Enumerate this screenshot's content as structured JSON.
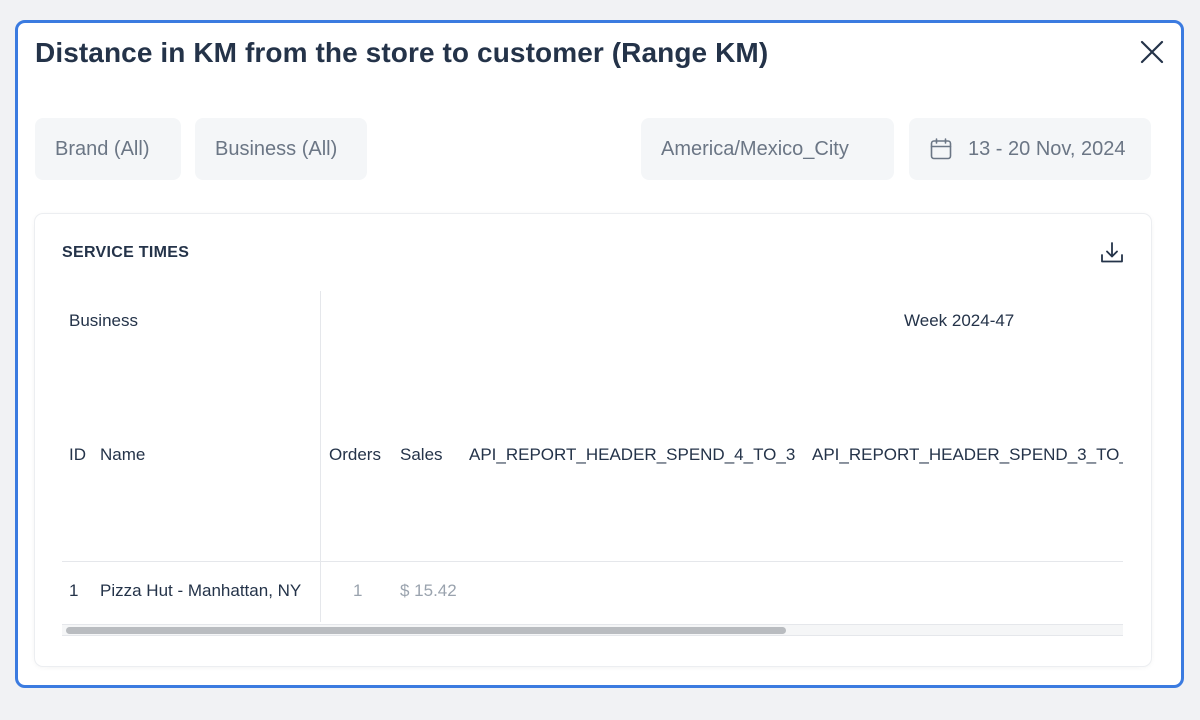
{
  "modal": {
    "title": "Distance in KM from the store to customer (Range KM)"
  },
  "filters": {
    "brand": "Brand (All)",
    "business": "Business (All)",
    "timezone": "America/Mexico_City",
    "date_range": "13 - 20 Nov, 2024"
  },
  "card": {
    "title": "SERVICE TIMES"
  },
  "table": {
    "group_headers": {
      "business": "Business",
      "week": "Week 2024-47"
    },
    "columns": {
      "id": "ID",
      "name": "Name",
      "orders": "Orders",
      "sales": "Sales",
      "spend_4_to_3": "API_REPORT_HEADER_SPEND_4_TO_3",
      "spend_3_to": "API_REPORT_HEADER_SPEND_3_TO_"
    },
    "rows": [
      {
        "id": "1",
        "name": "Pizza Hut - Manhattan, NY",
        "orders": "1",
        "sales": "$ 15.42"
      }
    ],
    "scroll_position": 0
  },
  "colors": {
    "accent_border": "#3b7be0",
    "title_text": "#243349",
    "filter_bg": "#f4f6f8",
    "muted_text": "#9aa3ae"
  },
  "icons": {
    "close": "close-icon",
    "calendar": "calendar-icon",
    "download": "download-icon"
  }
}
